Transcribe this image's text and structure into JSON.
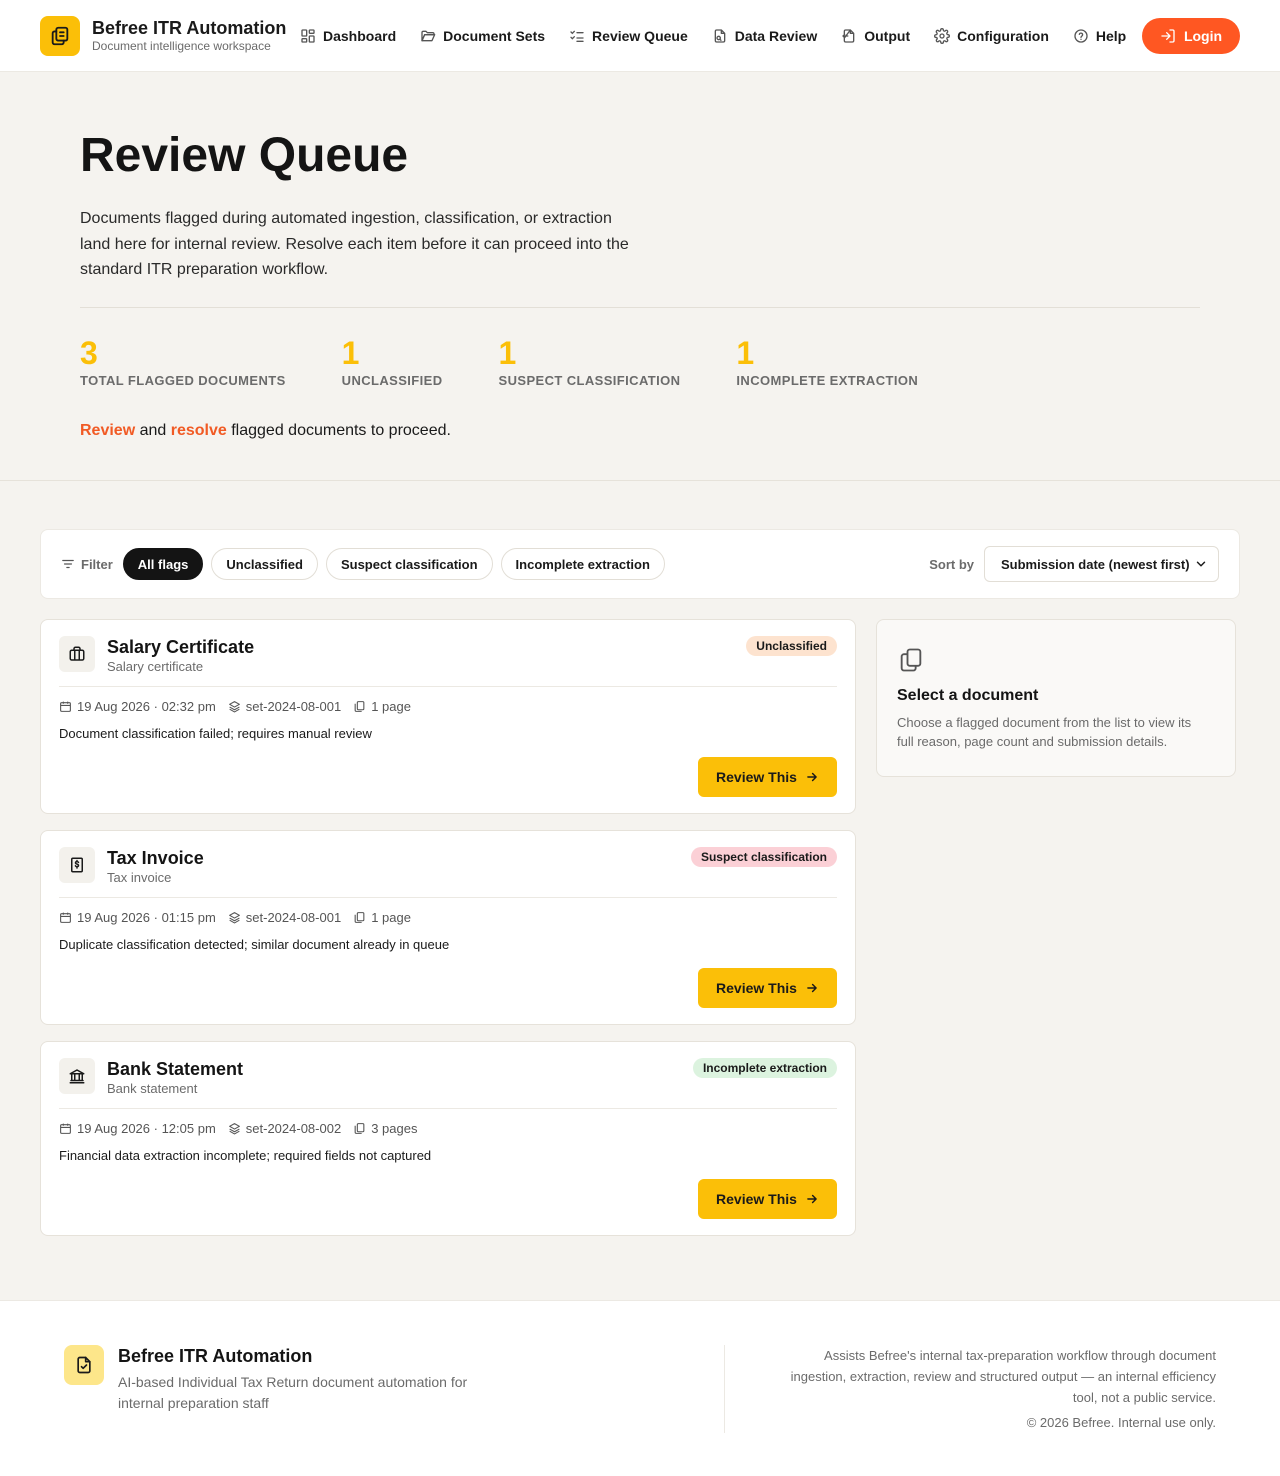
{
  "header": {
    "brand_title": "Befree ITR Automation",
    "brand_subtitle": "Document intelligence workspace",
    "nav": [
      {
        "label": "Dashboard",
        "icon": "dashboard-icon"
      },
      {
        "label": "Document Sets",
        "icon": "folder-icon"
      },
      {
        "label": "Review Queue",
        "icon": "list-check-icon"
      },
      {
        "label": "Data Review",
        "icon": "file-search-icon"
      },
      {
        "label": "Output",
        "icon": "file-export-icon"
      },
      {
        "label": "Configuration",
        "icon": "gear-icon"
      },
      {
        "label": "Help",
        "icon": "help-circle-icon"
      }
    ],
    "login_label": "Login"
  },
  "hero": {
    "title": "Review Queue",
    "description": "Documents flagged during automated ingestion, classification, or extraction land here for internal review. Resolve each item before it can proceed into the standard ITR preparation workflow.",
    "stats": [
      {
        "value": "3",
        "label": "TOTAL FLAGGED DOCUMENTS"
      },
      {
        "value": "1",
        "label": "UNCLASSIFIED"
      },
      {
        "value": "1",
        "label": "SUSPECT CLASSIFICATION"
      },
      {
        "value": "1",
        "label": "INCOMPLETE EXTRACTION"
      }
    ],
    "cta_word1": "Review",
    "cta_and": " and ",
    "cta_word2": "resolve",
    "cta_rest": " flagged documents to proceed."
  },
  "filter": {
    "label": "Filter",
    "chips": [
      "All flags",
      "Unclassified",
      "Suspect classification",
      "Incomplete extraction"
    ],
    "active_chip": "All flags",
    "sort_label": "Sort by",
    "sort_value": "Submission date (newest first)"
  },
  "documents": [
    {
      "title": "Salary Certificate",
      "subtitle": "Salary certificate",
      "icon": "briefcase-icon",
      "badge": "Unclassified",
      "badge_color": "#fde3cf",
      "date": "19 Aug 2026 · 02:32 pm",
      "set": "set-2024-08-001",
      "pages": "1 page",
      "reason": "Document classification failed; requires manual review",
      "action": "Review This"
    },
    {
      "title": "Tax Invoice",
      "subtitle": "Tax invoice",
      "icon": "receipt-dollar-icon",
      "badge": "Suspect classification",
      "badge_color": "#fbd0d6",
      "date": "19 Aug 2026 · 01:15 pm",
      "set": "set-2024-08-001",
      "pages": "1 page",
      "reason": "Duplicate classification detected; similar document already in queue",
      "action": "Review This"
    },
    {
      "title": "Bank Statement",
      "subtitle": "Bank statement",
      "icon": "bank-icon",
      "badge": "Incomplete extraction",
      "badge_color": "#dcf3df",
      "date": "19 Aug 2026 · 12:05 pm",
      "set": "set-2024-08-002",
      "pages": "3 pages",
      "reason": "Financial data extraction incomplete; required fields not captured",
      "action": "Review This"
    }
  ],
  "side_panel": {
    "title": "Select a document",
    "description": "Choose a flagged document from the list to view its full reason, page count and submission details."
  },
  "footer": {
    "title": "Befree ITR Automation",
    "description": "AI-based Individual Tax Return document automation for internal preparation staff",
    "note": "Assists Befree's internal tax-preparation workflow through document ingestion, extraction, review and structured output — an internal efficiency tool, not a public service.",
    "copyright": "© 2026 Befree. Internal use only."
  },
  "colors": {
    "accent_yellow": "#fbbf08",
    "accent_orange": "#ff5722",
    "background": "#f5f3ef"
  }
}
